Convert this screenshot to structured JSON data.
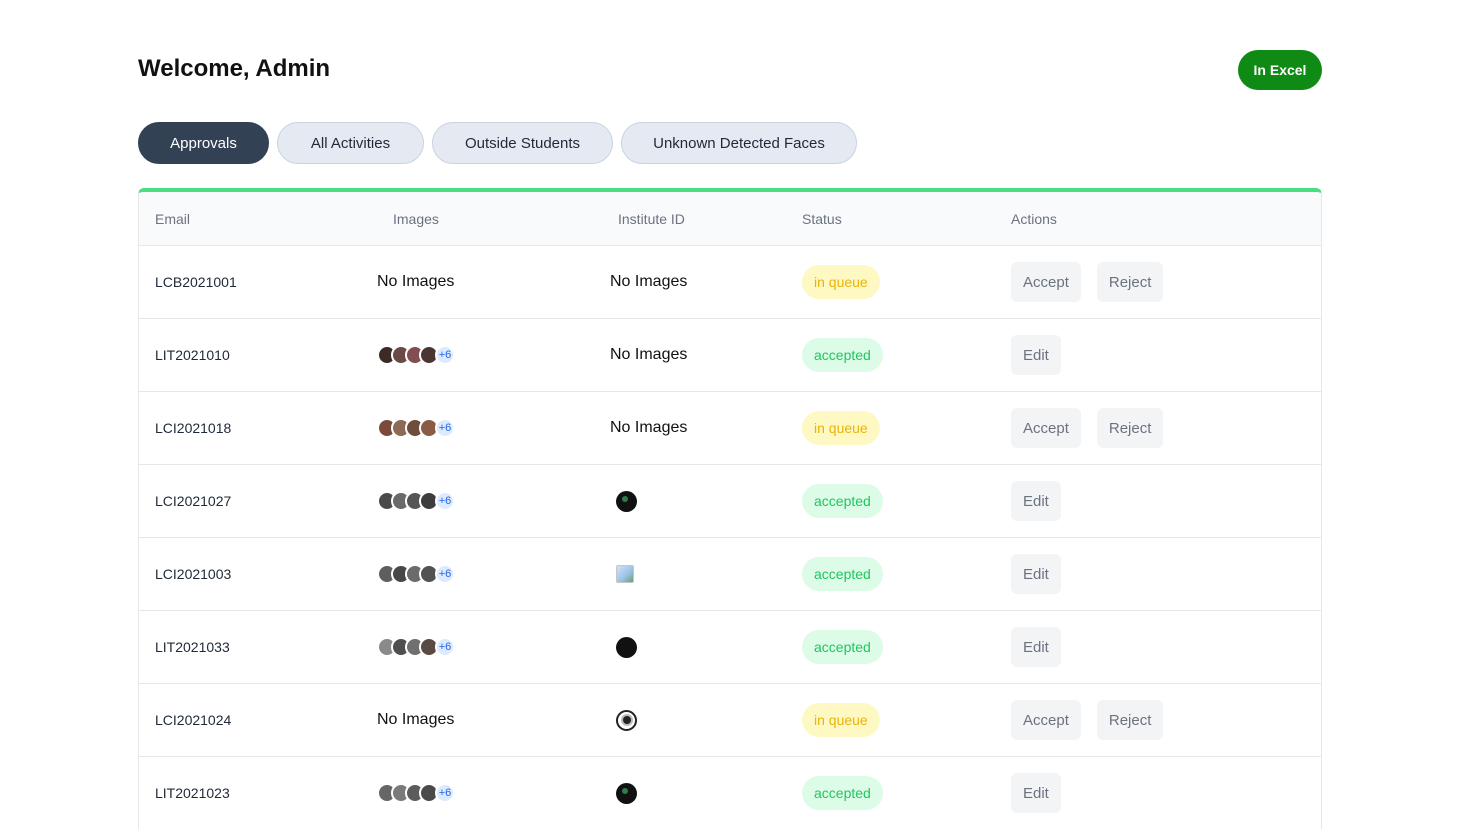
{
  "header": {
    "title": "Welcome, Admin",
    "excel_label": "In Excel"
  },
  "tabs": [
    {
      "label": "Approvals"
    },
    {
      "label": "All Activities"
    },
    {
      "label": "Outside Students"
    },
    {
      "label": "Unknown Detected Faces"
    }
  ],
  "table": {
    "columns": [
      "Email",
      "Images",
      "Institute ID",
      "Status",
      "Actions"
    ],
    "rows": [
      {
        "email": "LCB2021001",
        "images": "No Images",
        "institute_id": "No Images",
        "status": "in queue",
        "actions": [
          "Accept",
          "Reject"
        ]
      },
      {
        "email": "LIT2021010",
        "images_more": "+6",
        "institute_id": "No Images",
        "status": "accepted",
        "actions": [
          "Edit"
        ]
      },
      {
        "email": "LCI2021018",
        "images_more": "+6",
        "institute_id": "No Images",
        "status": "in queue",
        "actions": [
          "Accept",
          "Reject"
        ]
      },
      {
        "email": "LCI2021027",
        "images_more": "+6",
        "status": "accepted",
        "actions": [
          "Edit"
        ]
      },
      {
        "email": "LCI2021003",
        "images_more": "+6",
        "status": "accepted",
        "actions": [
          "Edit"
        ]
      },
      {
        "email": "LIT2021033",
        "images_more": "+6",
        "status": "accepted",
        "actions": [
          "Edit"
        ]
      },
      {
        "email": "LCI2021024",
        "images": "No Images",
        "status": "in queue",
        "actions": [
          "Accept",
          "Reject"
        ]
      },
      {
        "email": "LIT2021023",
        "images_more": "+6",
        "status": "accepted",
        "actions": [
          "Edit"
        ]
      }
    ]
  },
  "colors": {
    "accent_green": "#4ade80",
    "excel_green": "#0f8a15",
    "active_tab": "#334155"
  }
}
